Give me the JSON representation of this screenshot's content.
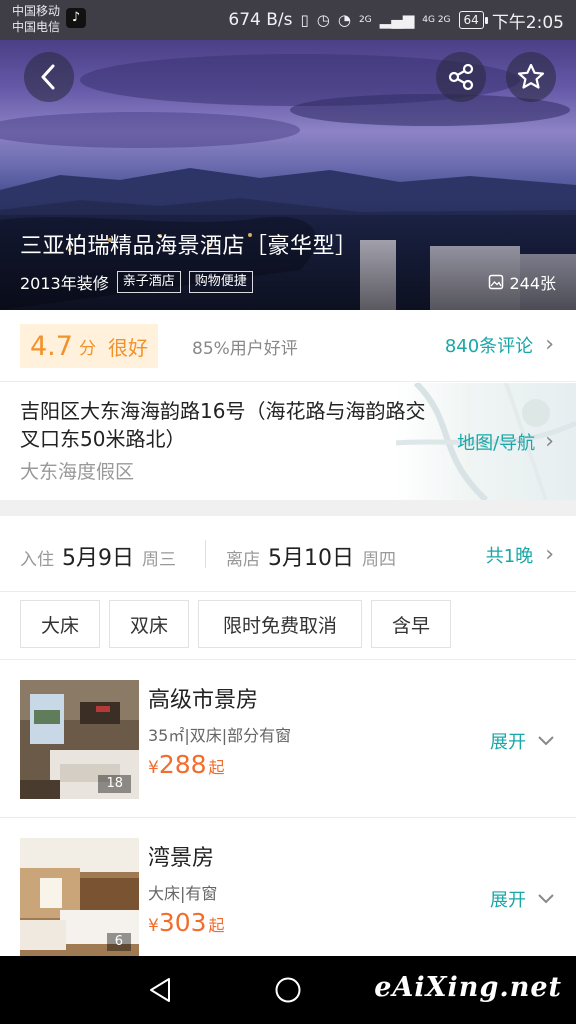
{
  "status_bar": {
    "carrier_1": "中国移动",
    "carrier_2": "中国电信",
    "net_speed": "674 B/s",
    "network_1": "2G",
    "network_2": "4G 2G",
    "battery": "64",
    "time": "下午2:05"
  },
  "hero": {
    "hotel_name": "三亚柏瑞精品海景酒店［豪华型］",
    "renovation": "2013年装修",
    "tags": [
      "亲子酒店",
      "购物便捷"
    ],
    "photo_count": "244张",
    "icons": [
      "back-icon",
      "share-icon",
      "star-icon",
      "photo-icon"
    ]
  },
  "rating": {
    "score": "4.7",
    "unit": "分",
    "word": "很好",
    "good_rate": "85%用户好评",
    "reviews": "840条评论"
  },
  "address": {
    "text": "吉阳区大东海海韵路16号（海花路与海韵路交叉口东50米路北）",
    "area": "大东海度假区",
    "map_link": "地图/导航"
  },
  "dates": {
    "checkin_label": "入住",
    "checkin_date": "5月9日",
    "checkin_weekday": "周三",
    "checkout_label": "离店",
    "checkout_date": "5月10日",
    "checkout_weekday": "周四",
    "nights": "共1晚"
  },
  "filters": [
    "大床",
    "双床",
    "限时免费取消",
    "含早"
  ],
  "rooms": [
    {
      "name": "高级市景房",
      "desc": "35㎡|双床|部分有窗",
      "currency": "¥",
      "price": "288",
      "suffix": "起",
      "image_count": "18",
      "expand": "展开"
    },
    {
      "name": "湾景房",
      "desc": "大床|有窗",
      "currency": "¥",
      "price": "303",
      "suffix": "起",
      "image_count": "6",
      "expand": "展开"
    }
  ],
  "watermark": "eAiXing.net",
  "colors": {
    "accent": "#1aa7a7",
    "price": "#f26d2d",
    "score": "#f2922b",
    "score_bg": "#fff1dc"
  }
}
